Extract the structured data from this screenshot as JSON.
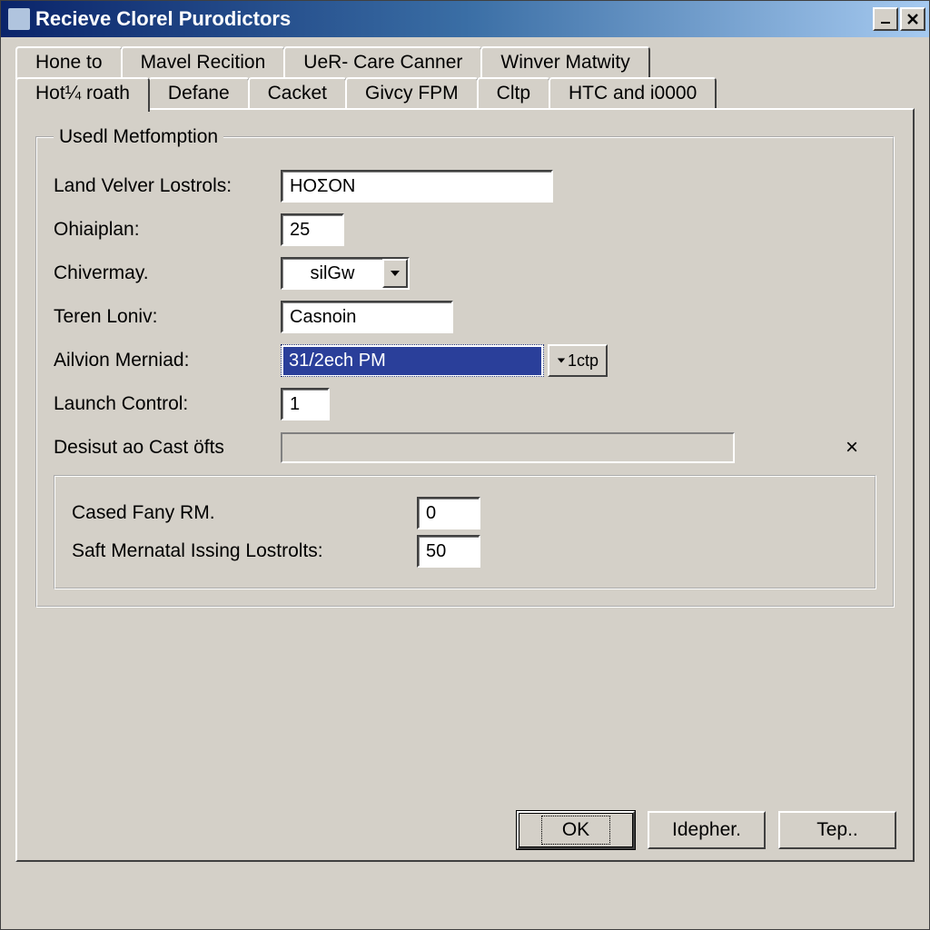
{
  "window": {
    "title": "Recieve Clorel Purodictors"
  },
  "tabs_row1": [
    {
      "label": "Hone to"
    },
    {
      "label": "Mavel Recition"
    },
    {
      "label": "UeR- Care Canner"
    },
    {
      "label": "Winver Matwity"
    }
  ],
  "tabs_row2": [
    {
      "label": "Hot¼ roath",
      "active": true
    },
    {
      "label": "Defane"
    },
    {
      "label": "Cacket"
    },
    {
      "label": "Givcy FPM"
    },
    {
      "label": "Cltp"
    },
    {
      "label": "HTC and i0000"
    }
  ],
  "group": {
    "legend": "Usedl Metfomption",
    "fields": {
      "land_velver": {
        "label": "Land Velver Lostrols:",
        "value": "HOΣON"
      },
      "ohaiplan": {
        "label": "Ohiaiplan:",
        "value": "25"
      },
      "chivermay": {
        "label": "Chivermay.",
        "value": "silGw"
      },
      "teren_loniv": {
        "label": "Teren Loniv:",
        "value": "Casnoin"
      },
      "ailvion": {
        "label": "Ailvion Merniad:",
        "value": "31/2ech PM",
        "btn_suffix": "1ctp"
      },
      "launch": {
        "label": "Launch Control:",
        "value": "1"
      },
      "desisut": {
        "label": "Desisut ao Cast öfts"
      }
    },
    "inner": {
      "cased_fany": {
        "label": "Cased Fany RM.",
        "value": "0"
      },
      "saft_mern": {
        "label": "Saft Mernatal Issing Lostrolts:",
        "value": "50"
      }
    }
  },
  "buttons": {
    "ok": "OK",
    "idepher": "Idepher.",
    "tep": "Tep.."
  }
}
